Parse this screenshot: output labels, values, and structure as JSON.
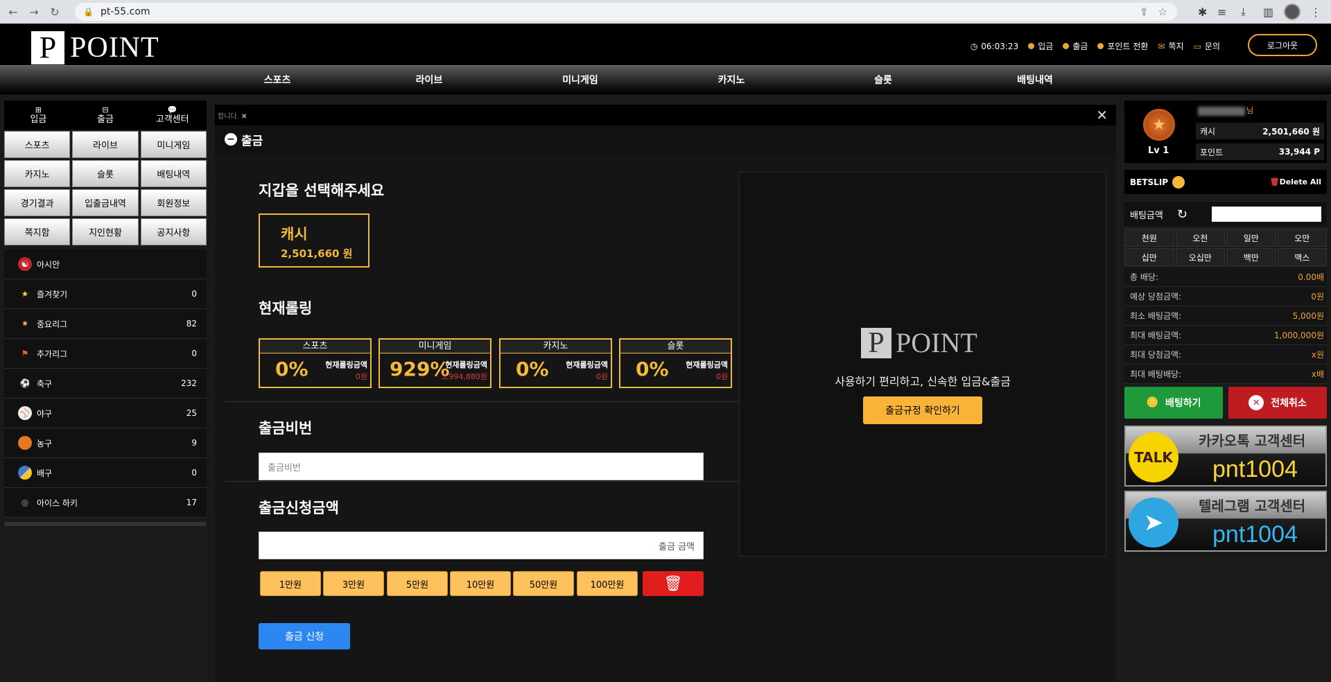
{
  "browser": {
    "url": "pt-55.com"
  },
  "header": {
    "logo_letter": "P",
    "logo_text": "POINT",
    "time": "06:03:23",
    "menu": [
      "입금",
      "출금",
      "포인트 전환",
      "쪽지",
      "문의"
    ],
    "logout": "로그아웃"
  },
  "nav": [
    "스포츠",
    "라이브",
    "미니게임",
    "카지노",
    "슬롯",
    "배팅내역"
  ],
  "left": {
    "quick": [
      "입금",
      "출금",
      "고객센터"
    ],
    "grid": [
      "스포츠",
      "라이브",
      "미니게임",
      "카지노",
      "슬롯",
      "배팅내역",
      "경기결과",
      "입출금내역",
      "회원정보",
      "쪽지함",
      "지인현황",
      "공지사항"
    ],
    "sports": [
      {
        "name": "아시안",
        "count": "",
        "icon": "asian-icon"
      },
      {
        "name": "즐겨찾기",
        "count": "0",
        "icon": "star-icon"
      },
      {
        "name": "중요리그",
        "count": "82",
        "icon": "league-icon"
      },
      {
        "name": "추가리그",
        "count": "0",
        "icon": "bookmark-icon"
      },
      {
        "name": "축구",
        "count": "232",
        "icon": "soccer-icon"
      },
      {
        "name": "야구",
        "count": "25",
        "icon": "baseball-icon"
      },
      {
        "name": "농구",
        "count": "9",
        "icon": "basketball-icon"
      },
      {
        "name": "배구",
        "count": "0",
        "icon": "volleyball-icon"
      },
      {
        "name": "아이스 하키",
        "count": "17",
        "icon": "hockey-icon"
      }
    ]
  },
  "center": {
    "ticker": "합니다. ✖",
    "title": "출금",
    "wallet_heading": "지갑을 선택해주세요",
    "cash_label": "캐시",
    "cash_value": "2,501,660 원",
    "rolling_heading": "현재롤링",
    "rolling": [
      {
        "title": "스포츠",
        "pct": "0%",
        "label": "현재롤링금액",
        "value": "0원"
      },
      {
        "title": "미니게임",
        "pct": "929%",
        "label": "현재롤링금액",
        "value": "3,994,880원"
      },
      {
        "title": "카지노",
        "pct": "0%",
        "label": "현재롤링금액",
        "value": "0원"
      },
      {
        "title": "슬롯",
        "pct": "0%",
        "label": "현재롤링금액",
        "value": "0원"
      }
    ],
    "pw_heading": "출금비번",
    "pw_placeholder": "출금비번",
    "amount_heading": "출금신청금액",
    "amount_placeholder": "출금 금액",
    "amounts": [
      "1만원",
      "3만원",
      "5만원",
      "10만원",
      "50만원",
      "100만원"
    ],
    "submit": "출금 신청",
    "promo_logo_letter": "P",
    "promo_logo_text": "POINT",
    "promo_tagline": "사용하기 편리하고, 신속한 입금&출금",
    "promo_button": "출금규정 확인하기"
  },
  "right": {
    "level": "Lv 1",
    "name_suffix": "님",
    "cash_label": "캐시",
    "cash_value": "2,501,660 원",
    "point_label": "포인트",
    "point_value": "33,944 P",
    "betslip": "BETSLIP",
    "delete_all": "Delete All",
    "bet_amount": "배팅금액",
    "chips": [
      "천원",
      "오천",
      "일만",
      "오만",
      "십만",
      "오십만",
      "백만",
      "맥스"
    ],
    "stats": [
      {
        "label": "총 배당:",
        "value": "0.00배"
      },
      {
        "label": "예상 당첨금액:",
        "value": "0원"
      },
      {
        "label": "최소 배팅금액:",
        "value": "5,000원"
      },
      {
        "label": "최대 배팅금액:",
        "value": "1,000,000원"
      },
      {
        "label": "최대 당첨금액:",
        "value": "x원"
      },
      {
        "label": "최대 배팅배당:",
        "value": "x배"
      }
    ],
    "bet_button": "배팅하기",
    "cancel_button": "전체취소",
    "kakao_title": "카카오톡 고객센터",
    "kakao_badge": "TALK",
    "kakao_id": "pnt1004",
    "telegram_title": "텔레그램 고객센터",
    "telegram_id": "pnt1004"
  }
}
